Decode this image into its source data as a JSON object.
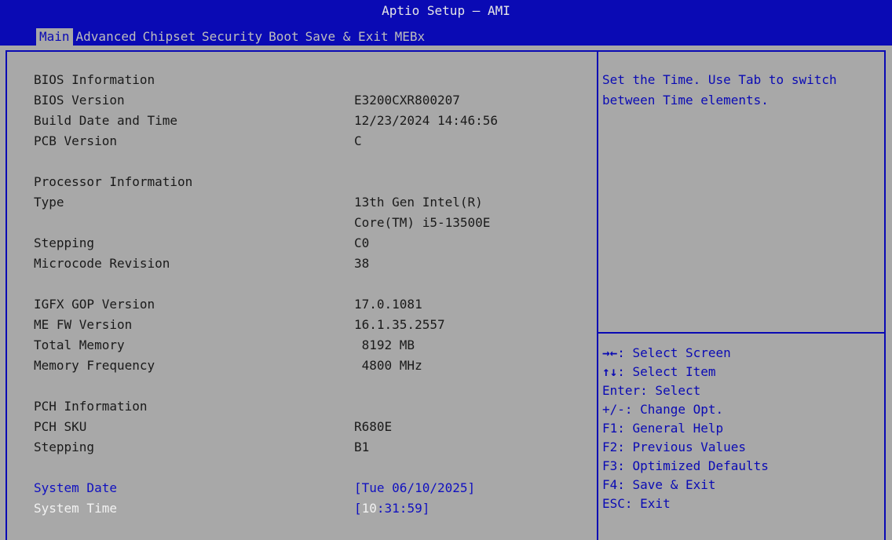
{
  "header": {
    "title": "Aptio Setup – AMI",
    "tabs": [
      {
        "label": "Main",
        "active": true
      },
      {
        "label": "Advanced",
        "active": false
      },
      {
        "label": "Chipset",
        "active": false
      },
      {
        "label": "Security",
        "active": false
      },
      {
        "label": "Boot",
        "active": false
      },
      {
        "label": "Save & Exit",
        "active": false
      },
      {
        "label": "MEBx",
        "active": false
      }
    ]
  },
  "main": {
    "bios_info": {
      "heading": "BIOS Information",
      "bios_version_label": "BIOS Version",
      "bios_version": "E3200CXR800207",
      "build_date_label": "Build Date and Time",
      "build_date": "12/23/2024 14:46:56",
      "pcb_version_label": "PCB Version",
      "pcb_version": "C"
    },
    "processor_info": {
      "heading": "Processor Information",
      "type_label": "Type",
      "type_line1": "13th Gen Intel(R)",
      "type_line2": "Core(TM) i5-13500E",
      "stepping_label": "Stepping",
      "stepping": "C0",
      "microcode_label": "Microcode Revision",
      "microcode": "38"
    },
    "other_info": {
      "igfx_label": "IGFX GOP Version",
      "igfx": "17.0.1081",
      "mefw_label": "ME FW Version",
      "mefw": "16.1.35.2557",
      "memory_label": "Total Memory",
      "memory": " 8192 MB",
      "freq_label": "Memory Frequency",
      "freq": " 4800 MHz"
    },
    "pch_info": {
      "heading": "PCH Information",
      "sku_label": "PCH SKU",
      "sku": "R680E",
      "stepping_label": "Stepping",
      "stepping": "B1"
    },
    "system_date": {
      "label": "System Date",
      "value": "[Tue 06/10/2025]"
    },
    "system_time": {
      "label": "System Time",
      "open_bracket": "[",
      "hour": "10",
      "rest": ":31:59]"
    }
  },
  "help": {
    "text": "Set the Time. Use Tab to switch between Time elements."
  },
  "keys": [
    {
      "key": "→←",
      "desc": ": Select Screen"
    },
    {
      "key": "↑↓",
      "desc": ": Select Item"
    },
    {
      "key": "",
      "desc": "Enter: Select"
    },
    {
      "key": "",
      "desc": "+/-: Change Opt."
    },
    {
      "key": "",
      "desc": "F1: General Help"
    },
    {
      "key": "",
      "desc": "F2: Previous Values"
    },
    {
      "key": "",
      "desc": "F3: Optimized Defaults"
    },
    {
      "key": "",
      "desc": "F4: Save & Exit"
    },
    {
      "key": "",
      "desc": "ESC: Exit"
    }
  ],
  "colors": {
    "background": "#a8a8a8",
    "accent_blue": "#0a0ab4",
    "highlight_white": "#f2f2f2"
  }
}
